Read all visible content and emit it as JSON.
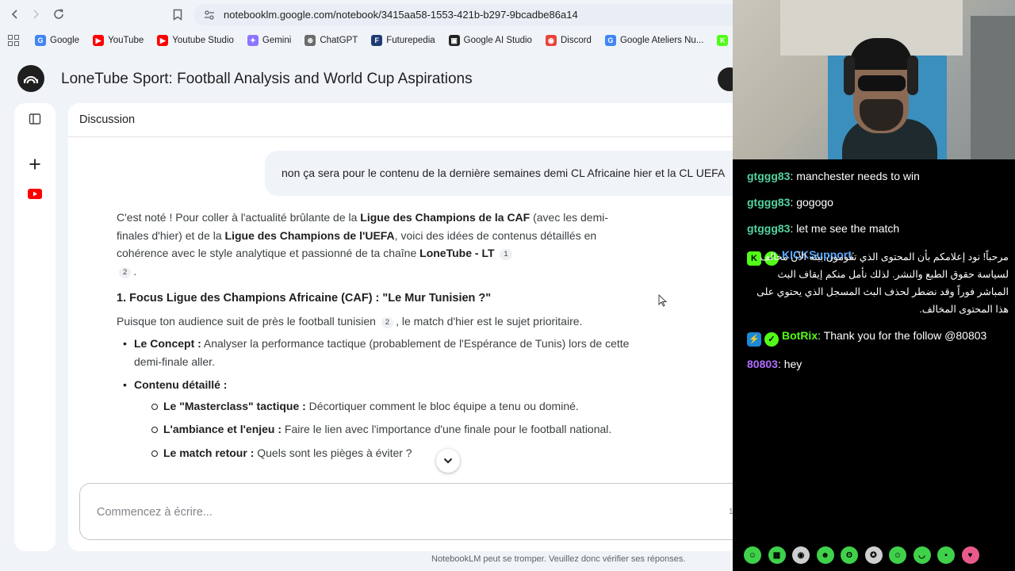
{
  "browser": {
    "url": "notebooklm.google.com/notebook/3415aa58-1553-421b-b297-9bcadbe86a14",
    "bookmarks": [
      {
        "label": "Google",
        "color": "#4285f4",
        "glyph": "G"
      },
      {
        "label": "YouTube",
        "color": "#ff0000",
        "glyph": "▶"
      },
      {
        "label": "Youtube Studio",
        "color": "#ff0000",
        "glyph": "▶"
      },
      {
        "label": "Gemini",
        "color": "#8e75ff",
        "glyph": "✦"
      },
      {
        "label": "ChatGPT",
        "color": "#6b6b6b",
        "glyph": "⊛"
      },
      {
        "label": "Futurepedia",
        "color": "#1f3b73",
        "glyph": "F"
      },
      {
        "label": "Google AI Studio",
        "color": "#222222",
        "glyph": "▣"
      },
      {
        "label": "Discord",
        "color": "#e8433b",
        "glyph": "◉"
      },
      {
        "label": "Google Ateliers Nu...",
        "color": "#4285f4",
        "glyph": "G"
      },
      {
        "label": "Ki",
        "color": "#53fc18",
        "glyph": "K"
      }
    ]
  },
  "notebook": {
    "title": "LoneTube Sport: Football Analysis and World Cup Aspirations",
    "panel_title": "Discussion",
    "user_message": "non ça sera pour le contenu de la dernière semaines demi CL Africaine hier et la CL UEFA",
    "ai": {
      "intro_1": "C'est noté ! Pour coller à l'actualité brûlante de la ",
      "intro_b1": "Ligue des Champions de la CAF",
      "intro_2": " (avec les demi-finales d'hier) et de la ",
      "intro_b2": "Ligue des Champions de l'UEFA",
      "intro_3": ", voici des idées de contenus détaillés en cohérence avec le style analytique et passionné de ta chaîne ",
      "intro_b3": "LoneTube - LT",
      "cite_1": "1",
      "cite_2": "2",
      "intro_end": ".",
      "section_1": "1. Focus Ligue des Champions Africaine (CAF) : \"Le Mur Tunisien ?\"",
      "para_1a": "Puisque ton audience suit de près le football tunisien",
      "para_1_cite": "2",
      "para_1b": ", le match d'hier est le sujet prioritaire.",
      "concept_label": "Le Concept :",
      "concept_text": " Analyser la performance tactique (probablement de l'Espérance de Tunis) lors de cette demi-finale aller.",
      "contenu_label": "Contenu détaillé :",
      "sub_1_label": "Le \"Masterclass\" tactique :",
      "sub_1_text": " Décortiquer comment le bloc équipe a tenu ou dominé.",
      "sub_2_label": "L'ambiance et l'enjeu :",
      "sub_2_text": " Faire le lien avec l'importance d'une finale pour le football national.",
      "sub_3_label": "Le match retour :",
      "sub_3_text": " Quels sont les pièges à éviter ?"
    },
    "composer_placeholder": "Commencez à écrire...",
    "composer_counter": "1",
    "disclaimer": "NotebookLM peut se tromper. Veuillez donc vérifier ses réponses."
  },
  "stream_chat": {
    "messages": [
      {
        "user": "gtggg83",
        "user_color": "#53d4a0",
        "text": "manchester needs to win"
      },
      {
        "user": "gtggg83",
        "user_color": "#53d4a0",
        "text": "gogogo"
      },
      {
        "user": "gtggg83",
        "user_color": "#53d4a0",
        "text": "let me see the match"
      },
      {
        "user": "KICKSupport",
        "user_color": "#5aa9ff",
        "text": "مرحباً! نود إعلامكم بأن المحتوى الذي تقومون ببثه الآن مخالف لسياسة حقوق الطبع والنشر. لذلك نأمل منكم إيقاف البث المباشر فوراً وقد نضطر لحذف البث المسجل الذي يحتوي على هذا المحتوى المخالف."
      },
      {
        "user": "BotRix",
        "user_color": "#53fc18",
        "text": "Thank you for the follow @80803"
      },
      {
        "user": "80803",
        "user_color": "#b06cff",
        "text": "hey"
      }
    ]
  }
}
